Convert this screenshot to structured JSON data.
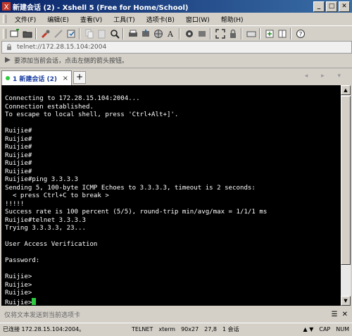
{
  "window": {
    "title": "新建会话 (2) - Xshell 5 (Free for Home/School)"
  },
  "window_controls": {
    "minimize": "_",
    "maximize": "□",
    "close": "✕"
  },
  "menu": [
    "文件(F)",
    "编辑(E)",
    "查看(V)",
    "工具(T)",
    "选项卡(B)",
    "窗口(W)",
    "帮助(H)"
  ],
  "address": {
    "value": "telnet://172.28.15.104:2004"
  },
  "hint": {
    "text": "要添加当前会话，点击左侧的箭头按钮。"
  },
  "tabs": [
    {
      "label": "1 新建会话 (2)",
      "close": "×"
    }
  ],
  "newtab": {
    "label": "+"
  },
  "tabnav": {
    "label": "◂ ▸ ▾"
  },
  "terminal": {
    "lines": "Connecting to 172.28.15.104:2004...\nConnection established.\nTo escape to local shell, press 'Ctrl+Alt+]'.\n\nRuijie#\nRuijie#\nRuijie#\nRuijie#\nRuijie#\nRuijie#\nRuijie#ping 3.3.3.3\nSending 5, 100-byte ICMP Echoes to 3.3.3.3, timeout is 2 seconds:\n  < press Ctrl+C to break >\n!!!!!\nSuccess rate is 100 percent (5/5), round-trip min/avg/max = 1/1/1 ms\nRuijie#telnet 3.3.3.3\nTrying 3.3.3.3, 23...\n\nUser Access Verification\n\nPassword:\n\nRuijie>\nRuijie>\nRuijie>\nRuijie>",
    "cursor_color": "#2ecc40"
  },
  "sendbar": {
    "placeholder": "仅将文本发送到当前选项卡"
  },
  "status": {
    "connection": "已连接 172.28.15.104:2004。",
    "protocol": "TELNET",
    "term": "xterm",
    "size": "90x27",
    "position": "27,8",
    "sessions": "1 会话",
    "caps": "CAP",
    "num": "NUM"
  },
  "colors": {
    "title_start": "#0a246a",
    "title_end": "#3a6ea5",
    "terminal_bg": "#000000",
    "terminal_fg": "#ffffff"
  }
}
